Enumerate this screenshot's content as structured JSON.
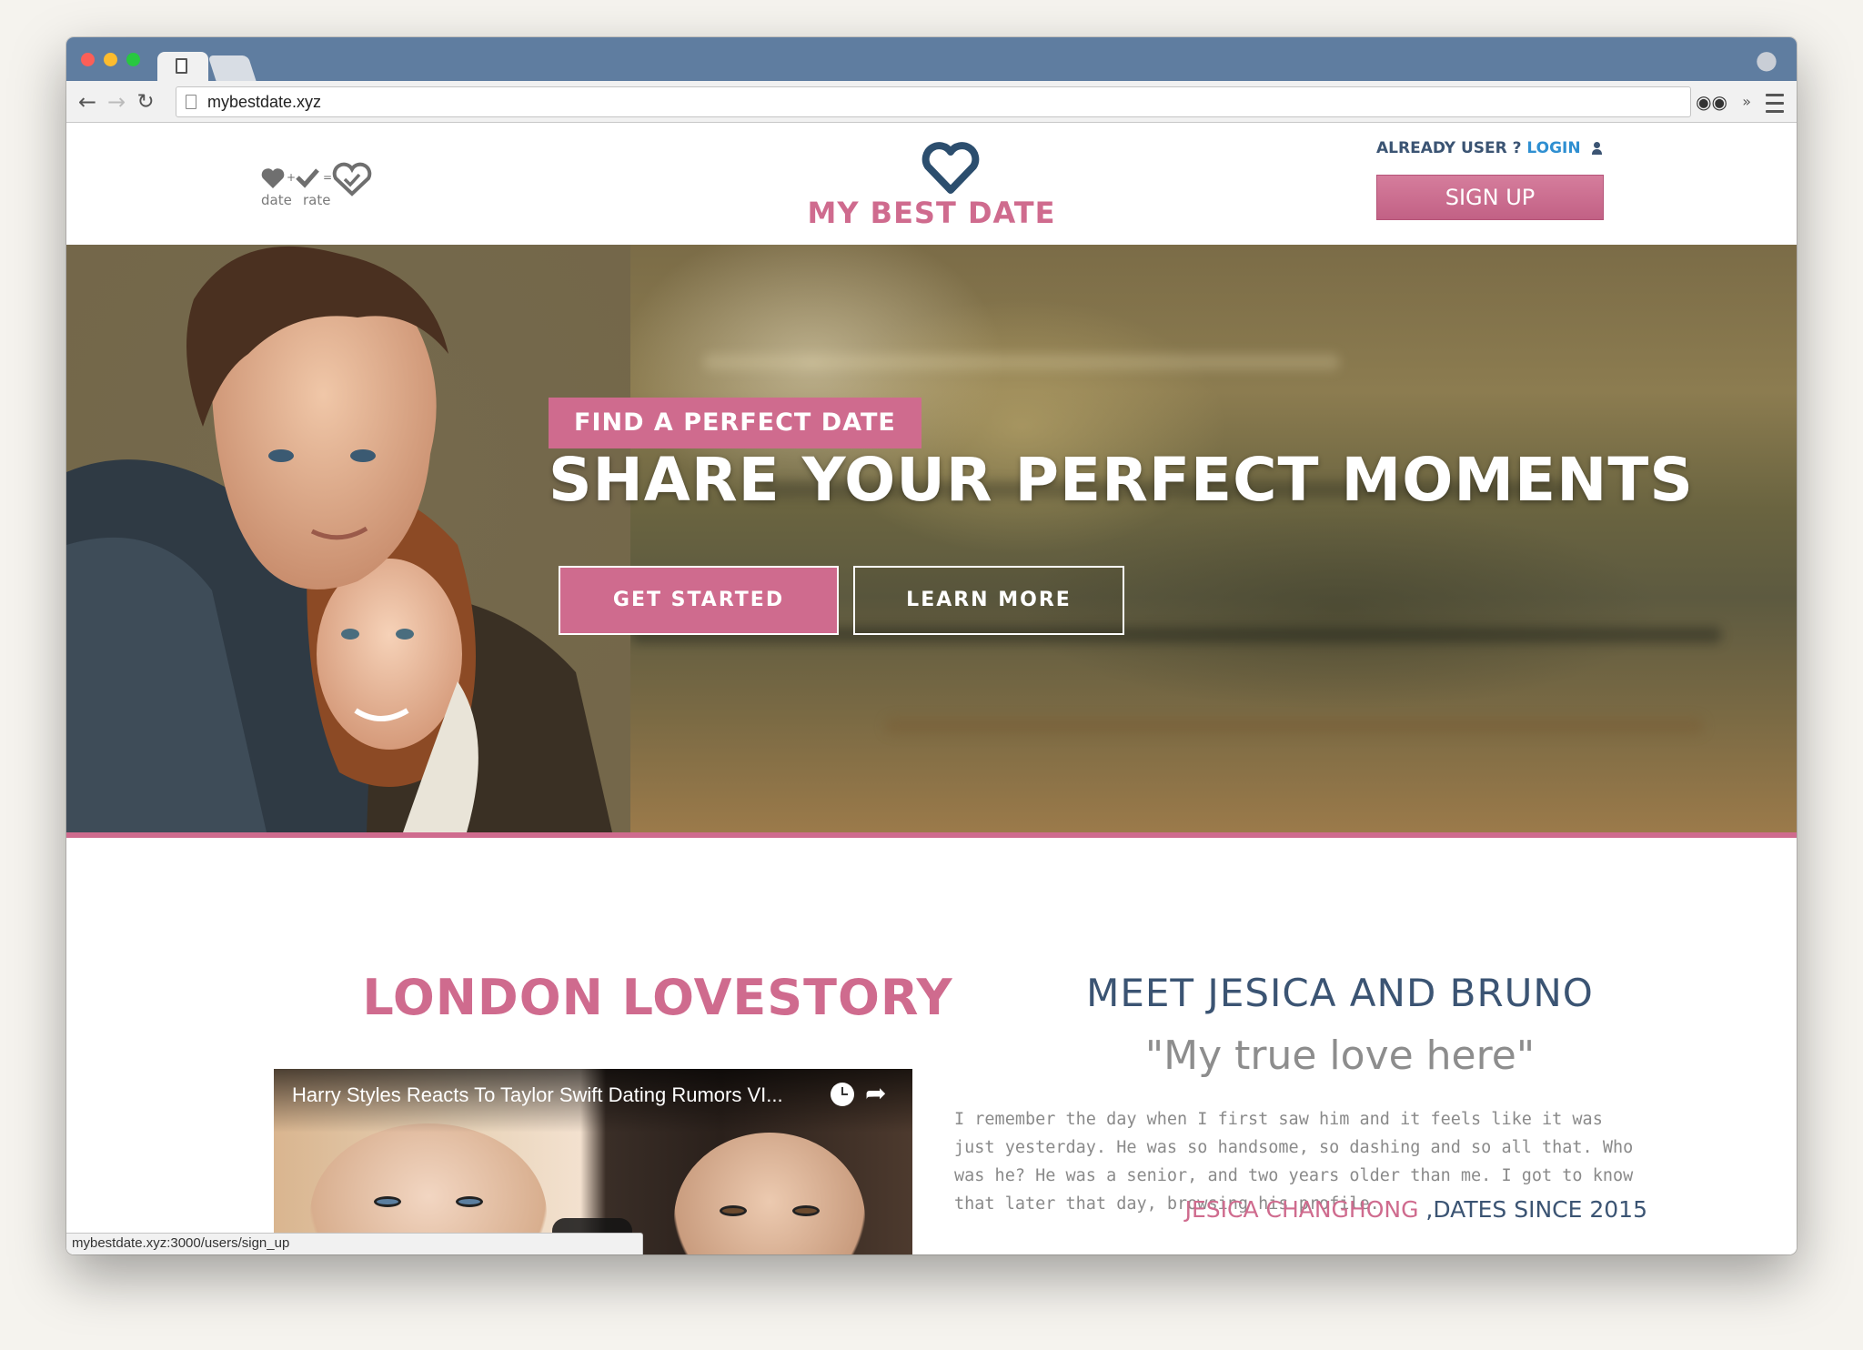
{
  "browser": {
    "url": "mybestdate.xyz",
    "status_url": "mybestdate.xyz:3000/users/sign_up"
  },
  "header": {
    "side_logo": {
      "word1": "date",
      "word2": "rate"
    },
    "brand_name": "MY BEST DATE",
    "already_user": "ALREADY USER ?",
    "login_label": "LOGIN",
    "signup_label": "SIGN UP"
  },
  "hero": {
    "tagline": "FIND A PERFECT DATE",
    "title": "SHARE YOUR PERFECT MOMENTS",
    "get_started": "GET STARTED",
    "learn_more": "LEARN MORE"
  },
  "story": {
    "title": "LONDON LOVESTORY",
    "video_title": "Harry Styles Reacts To Taylor Swift Dating Rumors VI..."
  },
  "testimonial": {
    "heading": "MEET JESICA AND BRUNO",
    "quote": "\"My true love here\"",
    "text": "I remember the day when I first saw him and it feels like it was just yesterday. He was so handsome, so dashing and so all that. Who was he? He was a senior, and two years older than me. I got to know that later that day, browsing his profile.",
    "author_name": "JESICA CHANGHONG ",
    "author_since": ",DATES SINCE 2015"
  },
  "colors": {
    "brand_pink": "#cf6b8e",
    "brand_navy": "#3b5473",
    "link_blue": "#2f8fd1",
    "titlebar": "#5f7da0"
  }
}
